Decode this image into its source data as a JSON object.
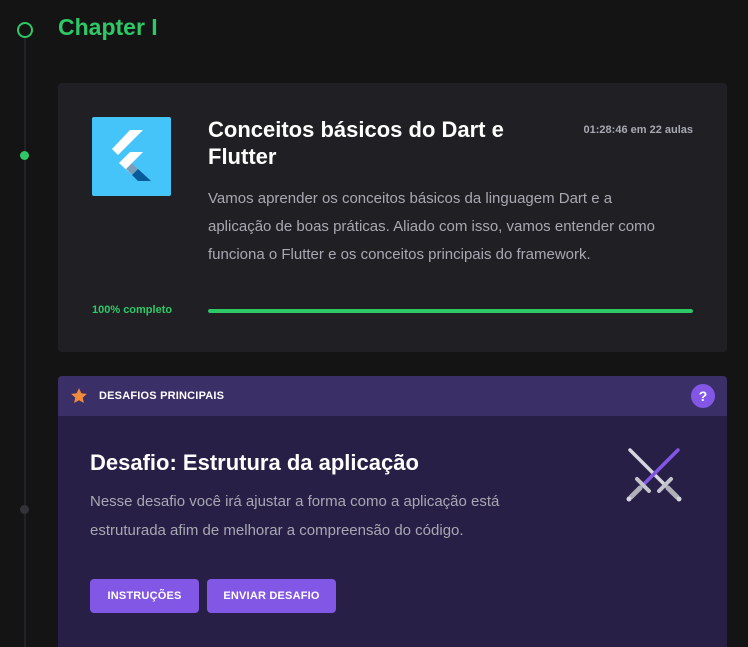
{
  "chapter": {
    "title": "Chapter I"
  },
  "module": {
    "title": "Conceitos básicos do Dart e Flutter",
    "duration": "01:28:46 em 22 aulas",
    "description": "Vamos aprender os conceitos básicos da linguagem Dart e a aplicação de boas práticas. Aliado com isso, vamos entender como funciona o Flutter e os conceitos principais do framework.",
    "progress_label": "100% completo",
    "progress_fraction": 1.0,
    "logo_icon": "flutter-logo-icon"
  },
  "challenge": {
    "section_label": "DESAFIOS PRINCIPAIS",
    "help_label": "?",
    "title": "Desafio: Estrutura da aplicação",
    "description": "Nesse desafio você irá ajustar a forma como a aplicação está estruturada afim de melhorar a compreensão do código.",
    "instructions_label": "INSTRUÇÕES",
    "submit_label": "ENVIAR DESAFIO",
    "icon": "crossed-swords-icon",
    "header_icon": "star-icon"
  },
  "colors": {
    "accent_green": "#2ec866",
    "accent_purple": "#8257e5",
    "star_orange": "#f08a3c",
    "flutter_blue": "#44c4f9"
  }
}
